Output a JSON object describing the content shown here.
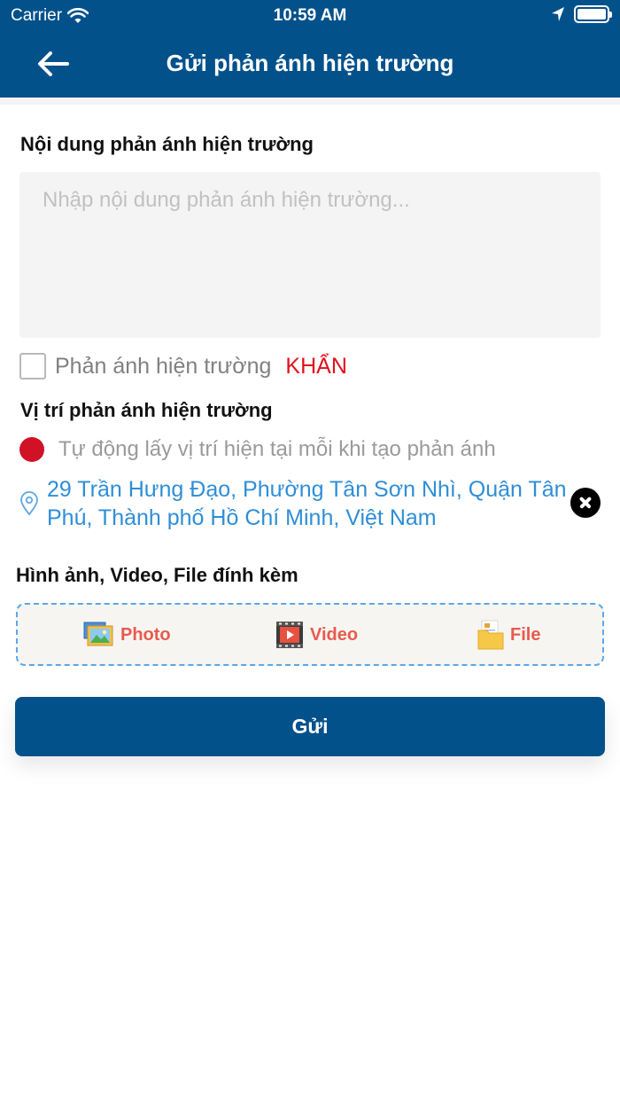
{
  "status_bar": {
    "carrier": "Carrier",
    "time": "10:59 AM"
  },
  "header": {
    "title": "Gửi phản ánh hiện trường",
    "background_color": "#03518b"
  },
  "content_section": {
    "title": "Nội dung phản ánh hiện trường",
    "placeholder": "Nhập nội dung phản ánh hiện trường...",
    "value": ""
  },
  "urgent_checkbox": {
    "label": "Phản ánh hiện trường",
    "urgent_text": "KHẨN",
    "checked": false
  },
  "location_section": {
    "title": "Vị trí phản ánh hiện trường",
    "auto_location_label": "Tự động lấy vị trí hiện tại mỗi khi tạo phản ánh",
    "address": "29 Trần Hưng Đạo, Phường Tân Sơn Nhì, Quận Tân Phú, Thành phố Hồ Chí Minh, Việt Nam"
  },
  "attachments": {
    "title": "Hình ảnh, Video, File đính kèm",
    "photo_label": "Photo",
    "video_label": "Video",
    "file_label": "File"
  },
  "submit_label": "Gửi",
  "colors": {
    "primary": "#03518b",
    "urgent": "#e3101c",
    "link": "#2f8ed6",
    "attach_label": "#e85a4f"
  }
}
